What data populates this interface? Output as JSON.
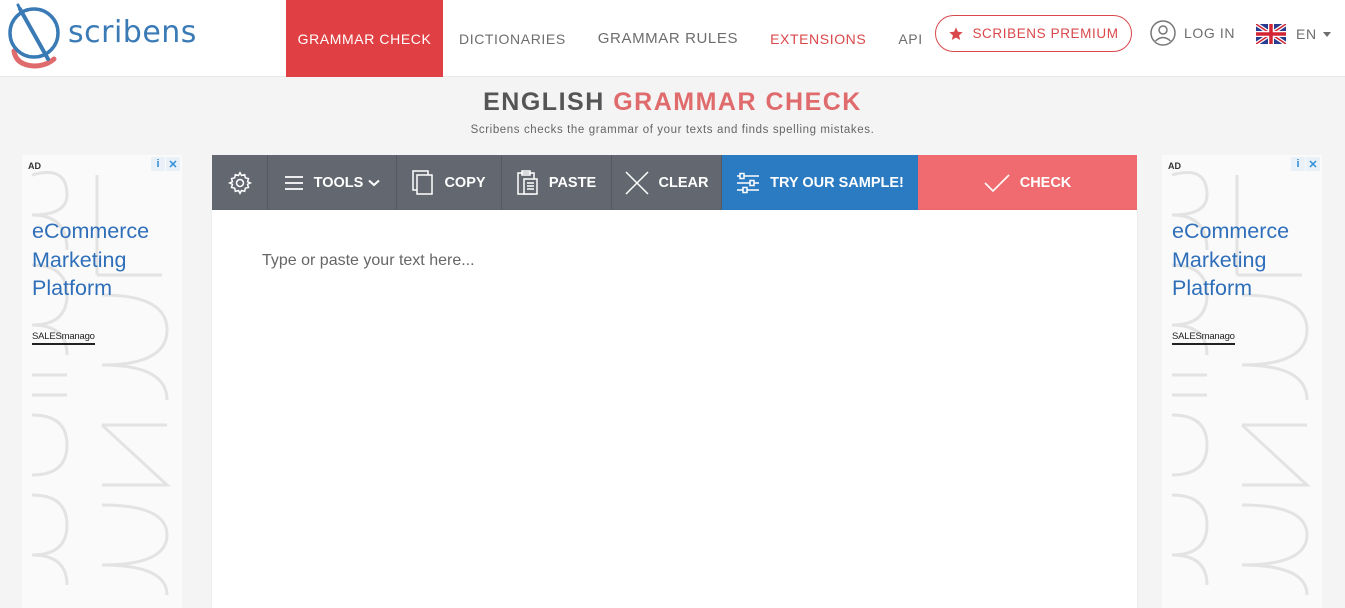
{
  "brand": {
    "name": "scribens"
  },
  "nav": {
    "items": [
      {
        "label": "GRAMMAR CHECK"
      },
      {
        "label": "DICTIONARIES"
      },
      {
        "label": "GRAMMAR RULES"
      },
      {
        "label": "EXTENSIONS"
      },
      {
        "label": "API"
      }
    ],
    "premium_label": "SCRIBENS PREMIUM",
    "login_label": "LOG IN",
    "language": "EN"
  },
  "page": {
    "title_part1": "ENGLISH",
    "title_part2": "GRAMMAR CHECK",
    "subtitle": "Scribens checks the grammar of your texts and finds spelling mistakes."
  },
  "toolbar": {
    "tools_label": "TOOLS",
    "copy_label": "COPY",
    "paste_label": "PASTE",
    "clear_label": "CLEAR",
    "sample_label": "TRY OUR SAMPLE!",
    "check_label": "CHECK"
  },
  "editor": {
    "value": "",
    "placeholder": "Type or paste your text here..."
  },
  "ads": {
    "label": "AD",
    "headline_line1": "eCommerce",
    "headline_line2": "Marketing",
    "headline_line3": "Platform",
    "brand": "SALESmanago"
  },
  "colors": {
    "primary_red": "#e04043",
    "check_red": "#ef6b6f",
    "sample_blue": "#2b7bc3",
    "toolbar_gray": "#636870",
    "brand_blue": "#3a7bb6"
  }
}
